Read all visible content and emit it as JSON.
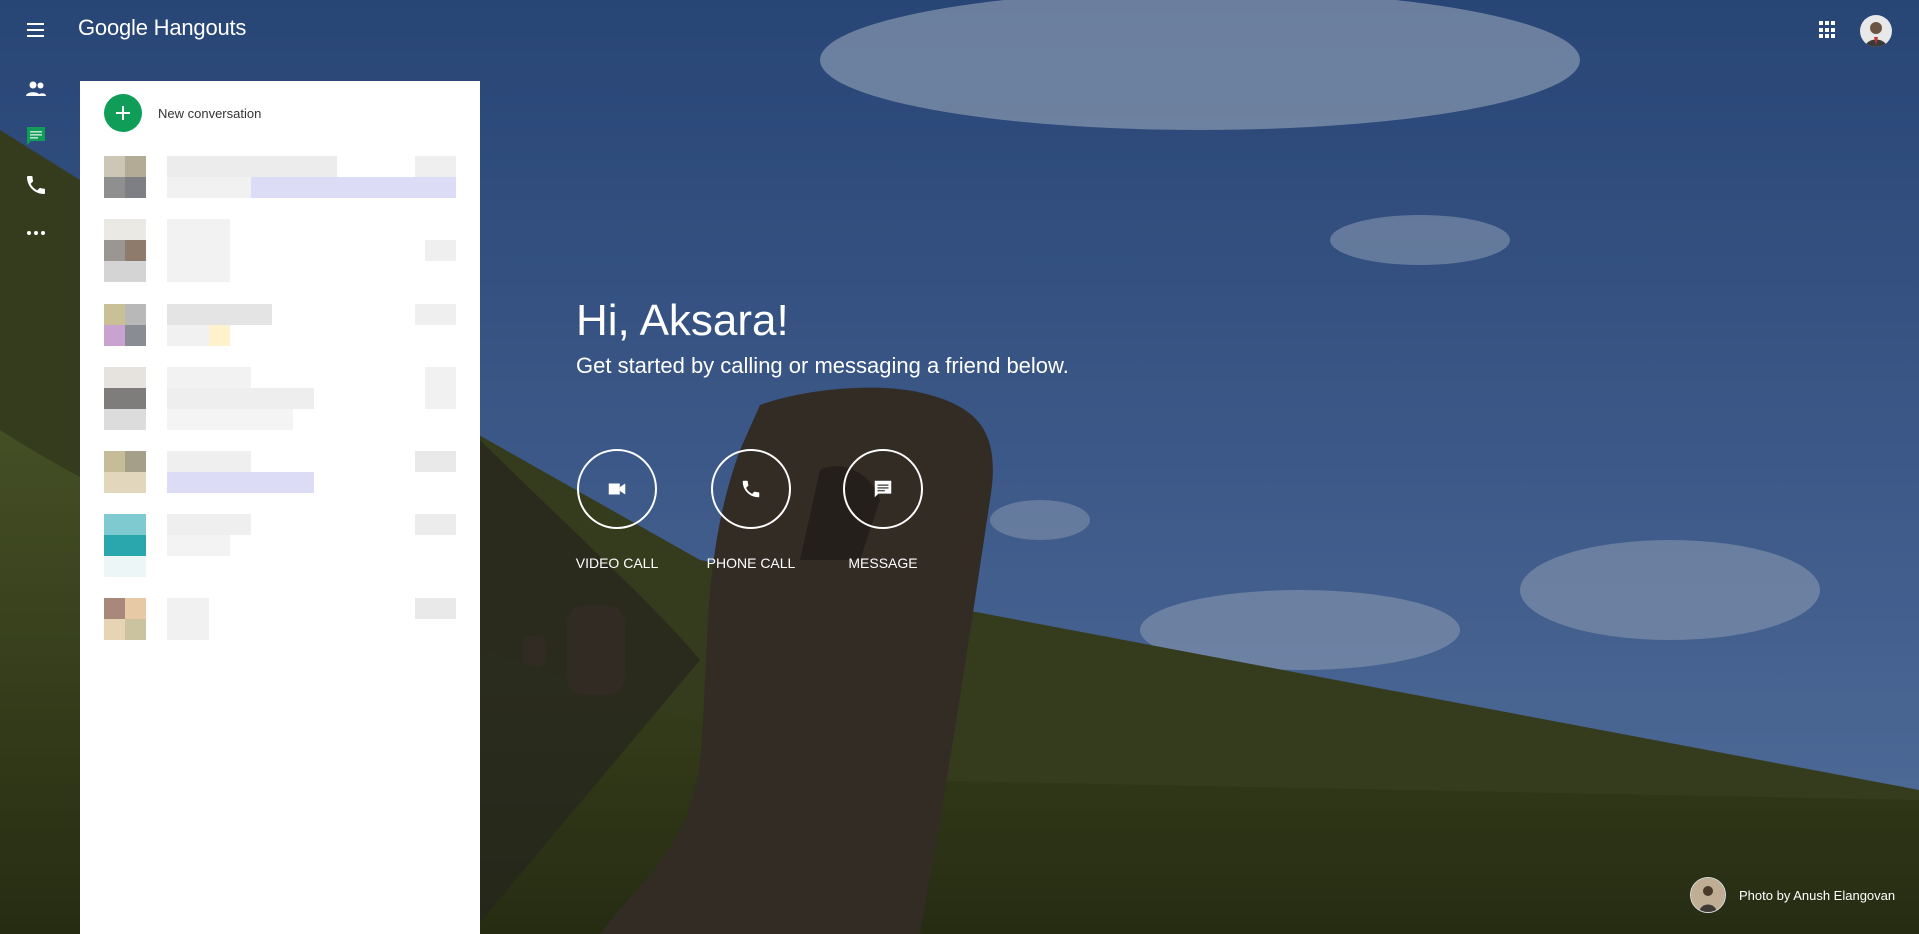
{
  "app": {
    "logo": "Google Hangouts"
  },
  "nav": {
    "icons": [
      "people-icon",
      "chat-icon",
      "phone-icon",
      "more-icon"
    ],
    "active": "chat-icon",
    "active_color": "#0f9d58"
  },
  "panel": {
    "new_conversation_label": "New conversation"
  },
  "welcome": {
    "greeting": "Hi, Aksara!",
    "subtitle": "Get started by calling or messaging a friend below."
  },
  "actions": [
    {
      "label": "VIDEO CALL",
      "icon": "videocam-icon"
    },
    {
      "label": "PHONE CALL",
      "icon": "phone-icon"
    },
    {
      "label": "MESSAGE",
      "icon": "message-icon"
    }
  ],
  "credit": {
    "text": "Photo by Anush Elangovan"
  },
  "colors": {
    "accent_green": "#0f9d58",
    "sky": "#3b5a8c"
  }
}
